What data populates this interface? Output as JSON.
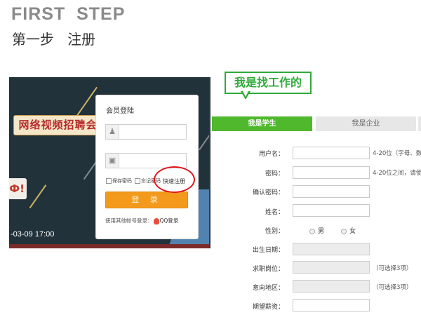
{
  "header": {
    "title_en": "FIRST  STEP",
    "title_cn": "第一步   注册"
  },
  "screenshot": {
    "banner": "网络视频招聘会",
    "side_card": "Ф!",
    "date": "-03-09 17:00",
    "login": {
      "title": "会员登陆",
      "remember": "保存密码",
      "forgot": "忘记密码",
      "quick_register": "快速注册",
      "button": "登 录",
      "other_login": "使用其他帐号登录：",
      "qq_login": "QQ登录"
    }
  },
  "callout": "我是找工作的",
  "tabs": {
    "student": "我是学生",
    "company": "我是企业"
  },
  "form": {
    "username_label": "用户名：",
    "username_hint": "4-20位（字母、数",
    "password_label": "密码：",
    "password_hint": "4-20位之间，请使",
    "confirm_label": "确认密码：",
    "name_label": "姓名：",
    "gender_label": "性别：",
    "gender_male": "男",
    "gender_female": "女",
    "birth_label": "出生日期：",
    "job_label": "求职岗位：",
    "job_hint": "（可选择3项）",
    "area_label": "意向地区：",
    "area_hint": "（可选择3项）",
    "salary_label": "期望薪资："
  }
}
